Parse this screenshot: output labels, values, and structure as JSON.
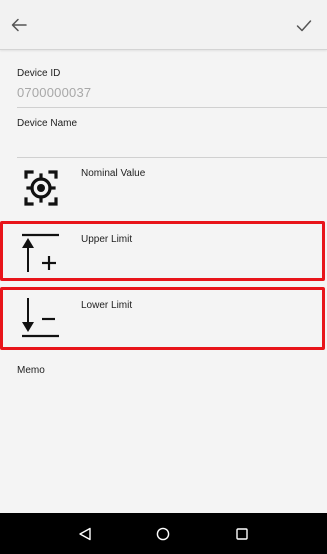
{
  "toolbar": {
    "back_icon": "arrow-left-icon",
    "confirm_icon": "checkmark-icon"
  },
  "form": {
    "device_id_label": "Device ID",
    "device_id_value": "0700000037",
    "device_name_label": "Device Name",
    "device_name_value": "",
    "nominal_label": "Nominal Value",
    "nominal_icon": "target-crosshair-icon",
    "upper_label": "Upper Limit",
    "upper_icon": "upper-limit-plus-icon",
    "lower_label": "Lower Limit",
    "lower_icon": "lower-limit-minus-icon",
    "memo_label": "Memo"
  },
  "highlight_color": "#e8141a",
  "navbar": {
    "back_icon": "nav-back-triangle-icon",
    "home_icon": "nav-home-circle-icon",
    "recents_icon": "nav-recents-square-icon"
  }
}
